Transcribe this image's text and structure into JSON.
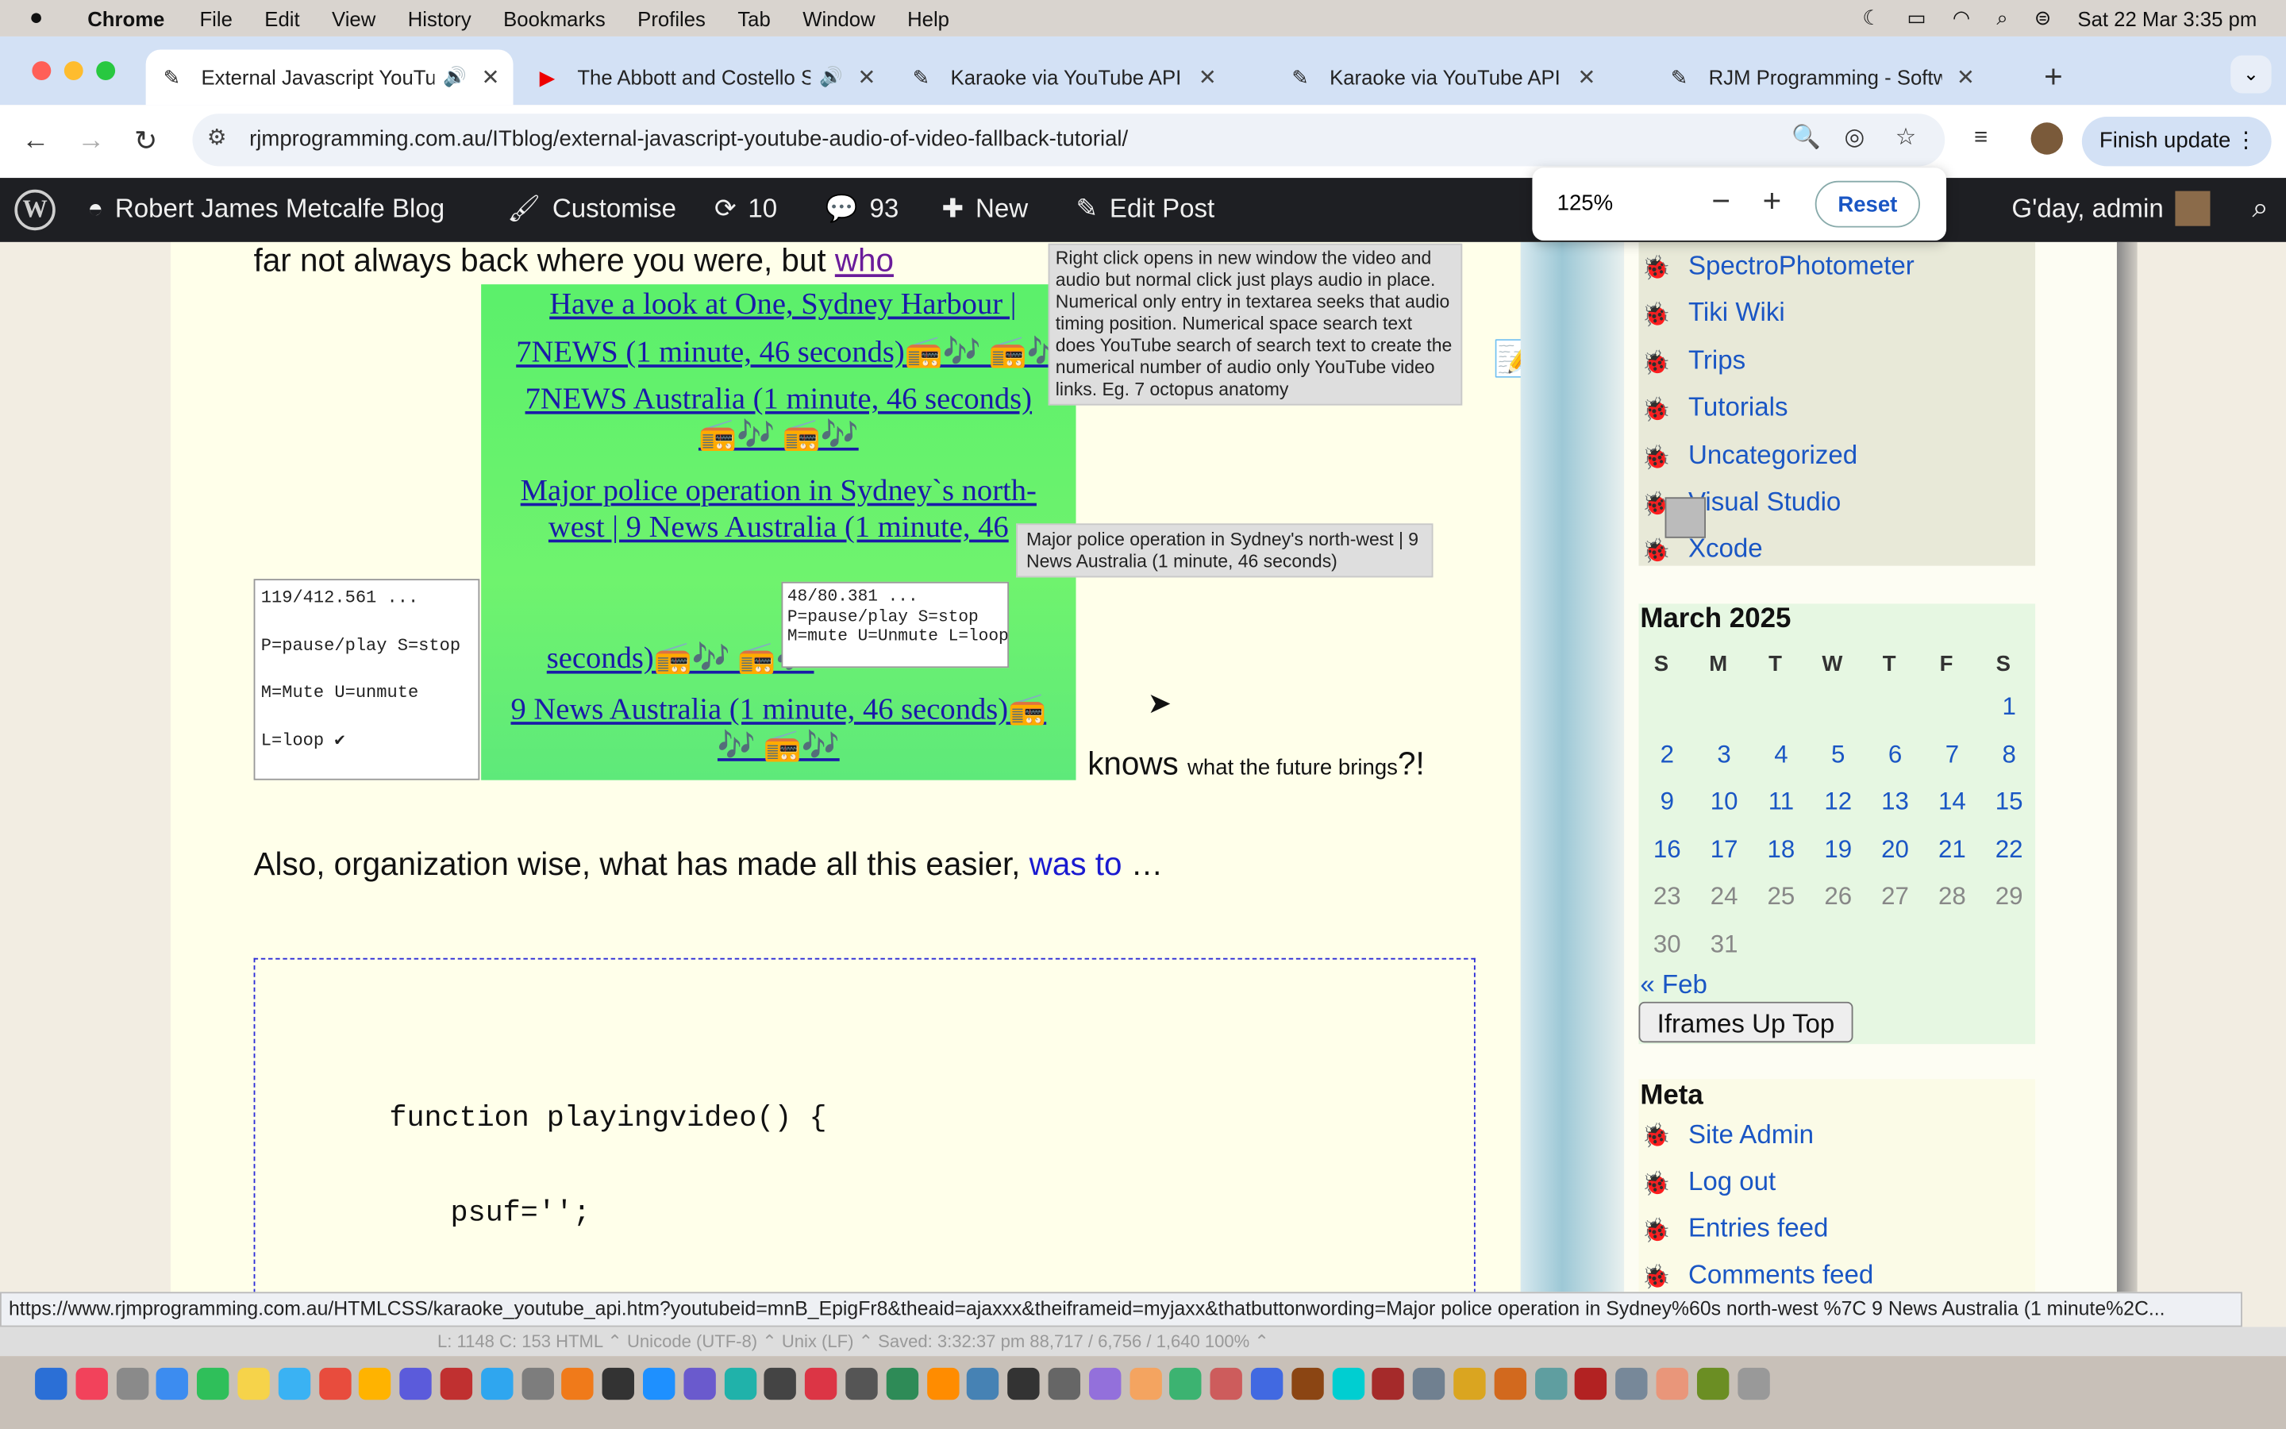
{
  "menubar": {
    "app": "Chrome",
    "items": [
      "File",
      "Edit",
      "View",
      "History",
      "Bookmarks",
      "Profiles",
      "Tab",
      "Window",
      "Help"
    ],
    "datetime": "Sat 22 Mar  3:35 pm"
  },
  "tabs": [
    {
      "title": "External Javascript YouTu",
      "active": true
    },
    {
      "title": "The Abbott and Costello S",
      "active": false
    },
    {
      "title": "Karaoke via YouTube API - RJI",
      "active": false
    },
    {
      "title": "Karaoke via YouTube API - RJI",
      "active": false
    },
    {
      "title": "RJM Programming - Software",
      "active": false
    }
  ],
  "toolbar": {
    "url": "rjmprogramming.com.au/ITblog/external-javascript-youtube-audio-of-video-fallback-tutorial/",
    "finish_update": "Finish update"
  },
  "zoom": {
    "level": "125%",
    "minus": "−",
    "plus": "+",
    "reset": "Reset"
  },
  "wpbar": {
    "site": "Robert James Metcalfe Blog",
    "customise": "Customise",
    "updates": "10",
    "comments": "93",
    "new": "New",
    "edit_post": "Edit Post",
    "greeting": "G'day, admin"
  },
  "content": {
    "line1_text": "far not always back where you were, but",
    "line1_link": "who",
    "green_links": [
      "Have a look at One, Sydney Harbour |",
      "7NEWS (1 minute, 46 seconds)📻🎶 📻🎶",
      "7NEWS Australia (1 minute, 46 seconds)",
      "📻🎶 📻🎶",
      "Major police operation in Sydney`s north-",
      "west | 9 News Australia (1 minute, 46",
      "seconds)📻🎶 📻🎶",
      "9 News Australia (1 minute, 46 seconds)📻",
      "🎶 📻🎶"
    ],
    "tooltip1": "Right click opens in new window the video and audio but normal click just plays audio in place. Numerical only entry in textarea seeks that audio timing position.  Numerical space search text does YouTube search of search text to create the numerical number of audio only YouTube video links.  Eg. 7 octopus anatomy",
    "tooltip2": "Major police operation in Sydney's north-west | 9 News Australia (1 minute, 46 seconds)",
    "textarea1": [
      "119/412.561 ...",
      "P=pause/play S=stop",
      "M=Mute U=unmute",
      "L=loop ✔"
    ],
    "textarea2": "48/80.381 ...\nP=pause/play S=stop\nM=mute U=Unmute L=loop",
    "knows": "knows",
    "knows_small": "what the future brings",
    "knows_end": "?!",
    "also_text": "Also, organization wise, what has made all this easier,",
    "also_link": "was to",
    "also_end": " …",
    "code_lines": [
      "function playingvideo() {",
      "psuf='';"
    ]
  },
  "sidebar": {
    "categories": [
      "SpectroPhotometer",
      "Tiki Wiki",
      "Trips",
      "Tutorials",
      "Uncategorized",
      "Visual Studio",
      "Xcode"
    ],
    "calendar_title": "March 2025",
    "dow": [
      "S",
      "M",
      "T",
      "W",
      "T",
      "F",
      "S"
    ],
    "days": [
      [
        "",
        "",
        "",
        "",
        "",
        "",
        "1"
      ],
      [
        "2",
        "3",
        "4",
        "5",
        "6",
        "7",
        "8"
      ],
      [
        "9",
        "10",
        "11",
        "12",
        "13",
        "14",
        "15"
      ],
      [
        "16",
        "17",
        "18",
        "19",
        "20",
        "21",
        "22"
      ],
      [
        "23",
        "24",
        "25",
        "26",
        "27",
        "28",
        "29"
      ],
      [
        "30",
        "31",
        "",
        "",
        "",
        "",
        ""
      ]
    ],
    "prev_month": "« Feb",
    "iframes_button": "Iframes Up Top",
    "meta_title": "Meta",
    "meta_links": [
      "Site Admin",
      "Log out",
      "Entries feed",
      "Comments feed"
    ]
  },
  "status_url": "https://www.rjmprogramming.com.au/HTMLCSS/karaoke_youtube_api.htm?youtubeid=mnB_EpigFr8&theaid=ajaxxx&theiframeid=myjaxx&thatbuttonwording=Major police operation in Sydney%60s north-west %7C 9 News Australia (1 minute%2C...",
  "editor_bar": "L: 1148 C: 153     HTML ⌃     Unicode (UTF-8) ⌃     Unix (LF) ⌃     Saved: 3:32:37 pm     88,717 / 6,756 / 1,640     100% ⌃"
}
